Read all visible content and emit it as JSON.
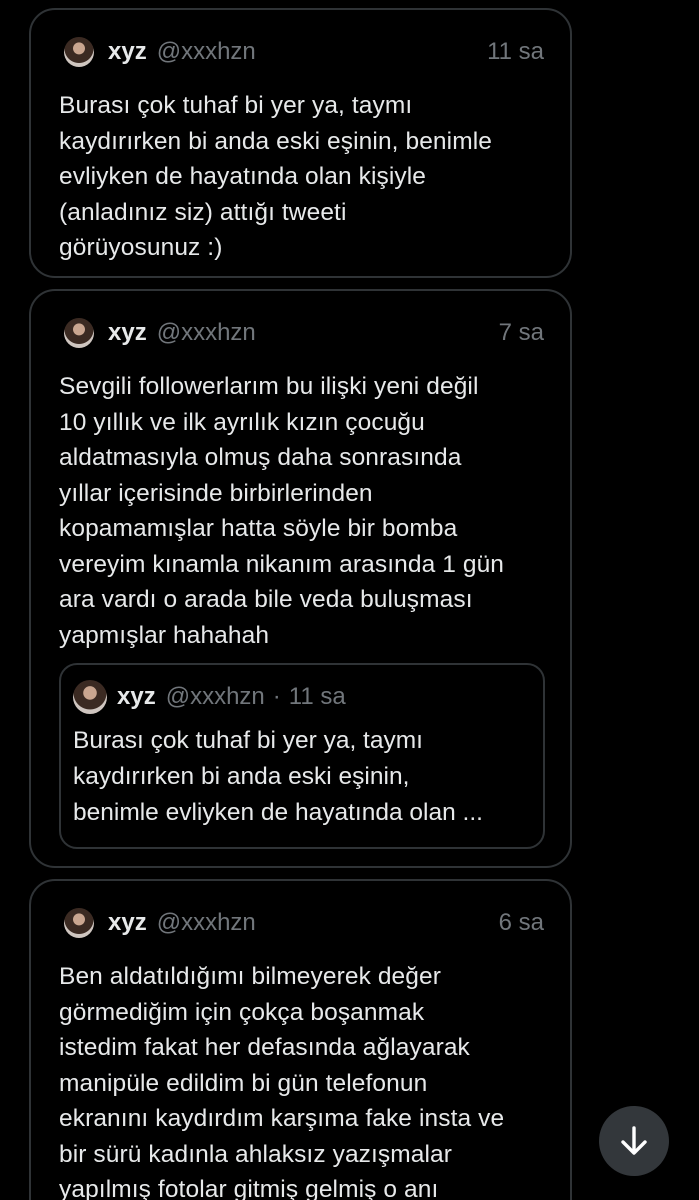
{
  "tweets": [
    {
      "name": "xyz",
      "handle": "@xxxhzn",
      "time": "11 sa",
      "text": "Burası çok tuhaf bi yer ya, taymı\nkaydırırken bi anda eski eşinin, benimle\nevliyken de hayatında olan kişiyle\n(anladınız siz) attığı tweeti\ngörüyosunuz :)"
    },
    {
      "name": "xyz",
      "handle": "@xxxhzn",
      "time": "7 sa",
      "text": "Sevgili followerlarım bu ilişki yeni değil\n10 yıllık ve ilk ayrılık kızın çocuğu\naldatmasıyla olmuş daha sonrasında\nyıllar içerisinde birbirlerinden\nkopamamışlar hatta söyle bir bomba\nvereyim kınamla nikanım arasında 1 gün\nara vardı o arada bile veda buluşması\nyapmışlar hahahah",
      "quote": {
        "name": "xyz",
        "handle": "@xxxhzn",
        "dot": "·",
        "time": "11 sa",
        "text": "Burası çok tuhaf bi yer ya, taymı\nkaydırırken bi anda eski eşinin,\nbenimle evliyken de hayatında olan ..."
      }
    },
    {
      "name": "xyz",
      "handle": "@xxxhzn",
      "time": "6 sa",
      "text": "Ben aldatıldığımı bilmeyerek değer\ngörmediğim için çokça boşanmak\nistedim fakat her defasında ağlayarak\nmanipüle edildim bi gün telefonun\nekranını kaydırdım karşıma fake insta ve\nbir sürü kadınla ahlaksız yazışmalar\nyapılmış fotolar gitmiş gelmiş o anı"
    }
  ],
  "icons": {
    "scroll_down": "arrow-down-icon"
  },
  "colors": {
    "background": "#000000",
    "border": "#2f3336",
    "text_primary": "#e7e9ea",
    "text_secondary": "#71767b",
    "fab": "#33373b"
  }
}
